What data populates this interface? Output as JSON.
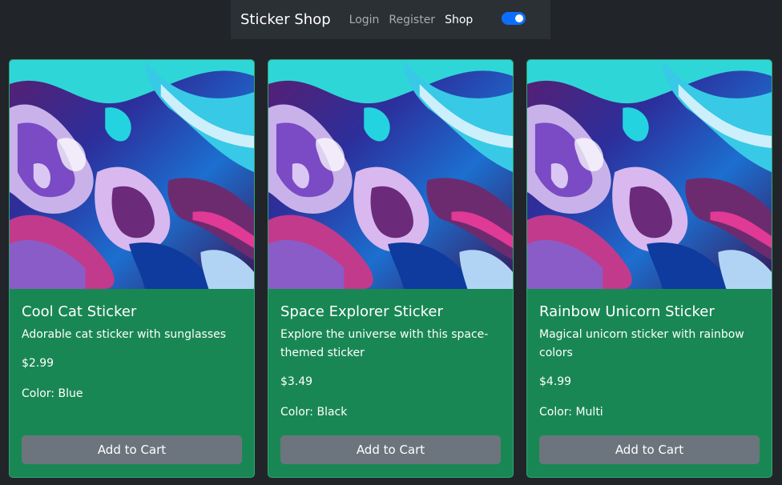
{
  "navbar": {
    "brand": "Sticker Shop",
    "links": [
      {
        "label": "Login",
        "active": false
      },
      {
        "label": "Register",
        "active": false
      },
      {
        "label": "Shop",
        "active": true
      }
    ],
    "theme_toggle": {
      "on": true
    }
  },
  "products": [
    {
      "title": "Cool Cat Sticker",
      "description": "Adorable cat sticker with sunglasses",
      "price": "$2.99",
      "color": "Color: Blue",
      "button": "Add to Cart"
    },
    {
      "title": "Space Explorer Sticker",
      "description": "Explore the universe with this space-themed sticker",
      "price": "$3.49",
      "color": "Color: Black",
      "button": "Add to Cart"
    },
    {
      "title": "Rainbow Unicorn Sticker",
      "description": "Magical unicorn sticker with rainbow colors",
      "price": "$4.99",
      "color": "Color: Multi",
      "button": "Add to Cart"
    }
  ],
  "colors": {
    "page_bg": "#212529",
    "navbar_bg": "#2b3035",
    "card_bg": "#198754",
    "button_bg": "#6c757d",
    "toggle_bg": "#0d6efd"
  }
}
